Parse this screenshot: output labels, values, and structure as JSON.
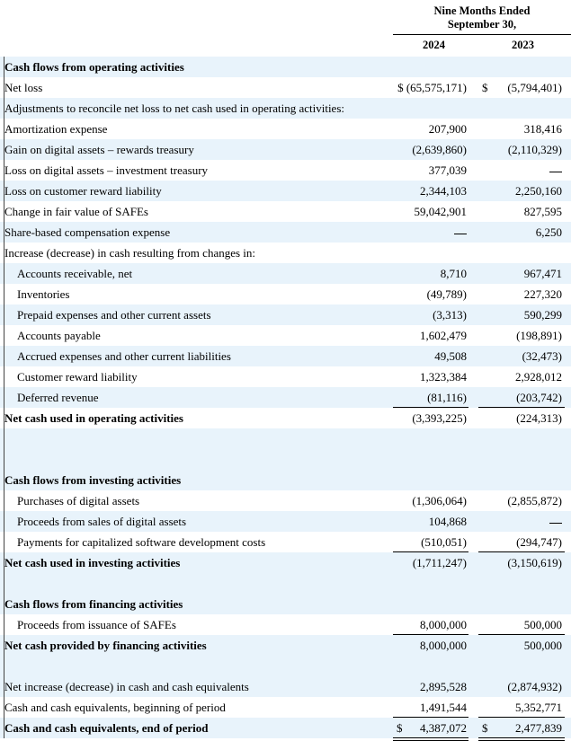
{
  "header": {
    "period_line1": "Nine Months Ended",
    "period_line2": "September 30,",
    "year_2024": "2024",
    "year_2023": "2023"
  },
  "rows": [
    {
      "label": "Cash flows from operating activities",
      "bold": true,
      "type": "heading"
    },
    {
      "label": "Net loss",
      "v2024": "$ (65,575,171)",
      "v2023": "(5,794,401)",
      "dollar2023": "$"
    },
    {
      "label": "Adjustments to reconcile net loss to net cash used in operating activities:"
    },
    {
      "label": "Amortization expense",
      "v2024": "207,900",
      "v2023": "318,416"
    },
    {
      "label": "Gain on digital assets – rewards treasury",
      "v2024": "(2,639,860)",
      "v2023": "(2,110,329)"
    },
    {
      "label": "Loss on digital assets – investment treasury",
      "v2024": "377,039",
      "v2023": "—"
    },
    {
      "label": "Loss on customer reward liability",
      "v2024": "2,344,103",
      "v2023": "2,250,160"
    },
    {
      "label": "Change in fair value of SAFEs",
      "v2024": "59,042,901",
      "v2023": "827,595"
    },
    {
      "label": "Share-based compensation expense",
      "v2024": "—",
      "v2023": "6,250"
    },
    {
      "label": "Increase (decrease) in cash resulting from changes in:"
    },
    {
      "label": "Accounts receivable, net",
      "indent": true,
      "v2024": "8,710",
      "v2023": "967,471"
    },
    {
      "label": "Inventories",
      "indent": true,
      "v2024": "(49,789)",
      "v2023": "227,320"
    },
    {
      "label": "Prepaid expenses and other current assets",
      "indent": true,
      "v2024": "(3,313)",
      "v2023": "590,299"
    },
    {
      "label": "Accounts payable",
      "indent": true,
      "v2024": "1,602,479",
      "v2023": "(198,891)"
    },
    {
      "label": "Accrued expenses and other current liabilities",
      "indent": true,
      "v2024": "49,508",
      "v2023": "(32,473)"
    },
    {
      "label": "Customer reward liability",
      "indent": true,
      "v2024": "1,323,384",
      "v2023": "2,928,012"
    },
    {
      "label": "Deferred revenue",
      "indent": true,
      "v2024": "(81,116)",
      "v2023": "(203,742)",
      "underline": true
    },
    {
      "label": "Net cash used in operating activities",
      "bold": true,
      "v2024": "(3,393,225)",
      "v2023": "(224,313)"
    },
    {
      "label": "",
      "type": "blank"
    },
    {
      "label": "",
      "type": "blank"
    },
    {
      "label": "Cash flows from investing activities",
      "bold": true,
      "type": "heading"
    },
    {
      "label": "Purchases of digital assets",
      "indent": true,
      "v2024": "(1,306,064)",
      "v2023": "(2,855,872)"
    },
    {
      "label": "Proceeds from sales of digital assets",
      "indent": true,
      "v2024": "104,868",
      "v2023": "—"
    },
    {
      "label": "Payments for capitalized software development costs",
      "indent": true,
      "v2024": "(510,051)",
      "v2023": "(294,747)",
      "underline": true
    },
    {
      "label": "Net cash used in investing activities",
      "bold": true,
      "v2024": "(1,711,247)",
      "v2023": "(3,150,619)"
    },
    {
      "label": "",
      "type": "blank"
    },
    {
      "label": "Cash flows from financing activities",
      "bold": true,
      "type": "heading"
    },
    {
      "label": "Proceeds from issuance of SAFEs",
      "indent": true,
      "v2024": "8,000,000",
      "v2023": "500,000",
      "underline": true
    },
    {
      "label": "Net cash provided by financing activities",
      "bold": true,
      "v2024": "8,000,000",
      "v2023": "500,000"
    },
    {
      "label": "",
      "type": "blank"
    },
    {
      "label": "Net increase (decrease) in cash and cash equivalents",
      "v2024": "2,895,528",
      "v2023": "(2,874,932)"
    },
    {
      "label": "Cash and cash equivalents, beginning of period",
      "v2024": "1,491,544",
      "v2023": "5,352,771",
      "underline": true
    },
    {
      "label": "Cash and cash equivalents, end of period",
      "bold": true,
      "v2024": "4,387,072",
      "v2023": "2,477,839",
      "dollar2024": "$",
      "dollar2023": "$",
      "double": true
    }
  ]
}
